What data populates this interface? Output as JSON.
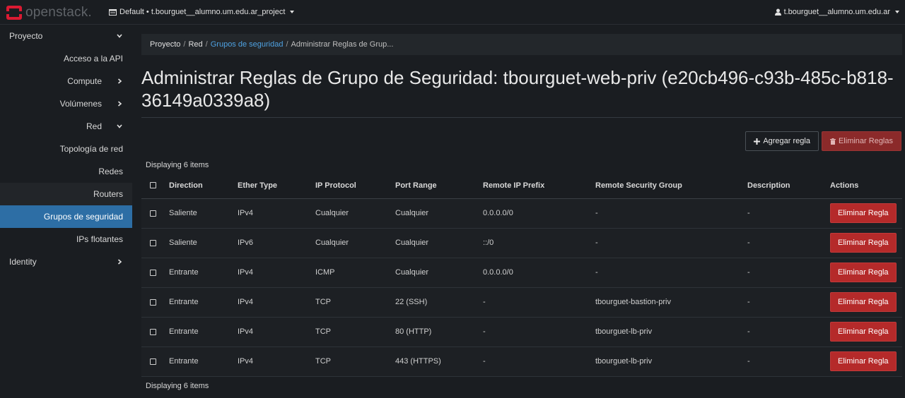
{
  "header": {
    "logo_text": "openstack.",
    "project_label": "Default • t.bourguet__alumno.um.edu.ar_project",
    "user_label": "t.bourguet__alumno.um.edu.ar"
  },
  "sidebar": {
    "items": [
      {
        "label": "Proyecto"
      },
      {
        "label": "Acceso a la API"
      },
      {
        "label": "Compute"
      },
      {
        "label": "Volúmenes"
      },
      {
        "label": "Red"
      },
      {
        "label": "Topología de red"
      },
      {
        "label": "Redes"
      },
      {
        "label": "Routers"
      },
      {
        "label": "Grupos de seguridad"
      },
      {
        "label": "IPs flotantes"
      },
      {
        "label": "Identity"
      }
    ]
  },
  "breadcrumb": {
    "items": [
      "Proyecto",
      "Red",
      "Grupos de seguridad",
      "Administrar Reglas de Grup..."
    ]
  },
  "page": {
    "title": "Administrar Reglas de Grupo de Seguridad: tbourguet-web-priv (e20cb496-c93b-485c-b818-36149a0339a8)"
  },
  "toolbar": {
    "add_label": "Agregar regla",
    "delete_label": "Eliminar Reglas"
  },
  "table": {
    "count_label": "Displaying 6 items",
    "columns": [
      "Direction",
      "Ether Type",
      "IP Protocol",
      "Port Range",
      "Remote IP Prefix",
      "Remote Security Group",
      "Description",
      "Actions"
    ],
    "rows": [
      {
        "direction": "Saliente",
        "ether": "IPv4",
        "protocol": "Cualquier",
        "port": "Cualquier",
        "prefix": "0.0.0.0/0",
        "group": "-",
        "description": "-",
        "action": "Eliminar Regla"
      },
      {
        "direction": "Saliente",
        "ether": "IPv6",
        "protocol": "Cualquier",
        "port": "Cualquier",
        "prefix": "::/0",
        "group": "-",
        "description": "-",
        "action": "Eliminar Regla"
      },
      {
        "direction": "Entrante",
        "ether": "IPv4",
        "protocol": "ICMP",
        "port": "Cualquier",
        "prefix": "0.0.0.0/0",
        "group": "-",
        "description": "-",
        "action": "Eliminar Regla"
      },
      {
        "direction": "Entrante",
        "ether": "IPv4",
        "protocol": "TCP",
        "port": "22 (SSH)",
        "prefix": "-",
        "group": "tbourguet-bastion-priv",
        "description": "-",
        "action": "Eliminar Regla"
      },
      {
        "direction": "Entrante",
        "ether": "IPv4",
        "protocol": "TCP",
        "port": "80 (HTTP)",
        "prefix": "-",
        "group": "tbourguet-lb-priv",
        "description": "-",
        "action": "Eliminar Regla"
      },
      {
        "direction": "Entrante",
        "ether": "IPv4",
        "protocol": "TCP",
        "port": "443 (HTTPS)",
        "prefix": "-",
        "group": "tbourguet-lb-priv",
        "description": "-",
        "action": "Eliminar Regla"
      }
    ]
  },
  "colors": {
    "accent": "#2d6ea5",
    "danger": "#b52a2a",
    "link": "#4ea1e0",
    "logo": "#da1a32"
  }
}
